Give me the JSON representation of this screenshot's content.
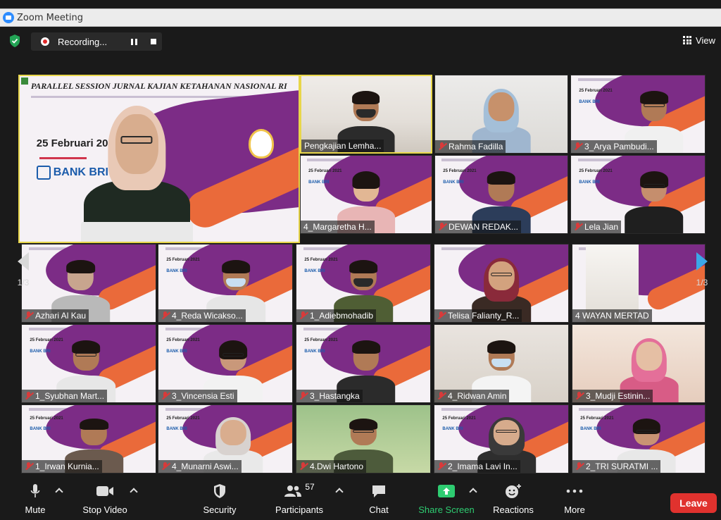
{
  "window": {
    "title": "Zoom Meeting"
  },
  "topbar": {
    "recording_label": "Recording...",
    "view_label": "View"
  },
  "speaker": {
    "slide_title": "PARALLEL SESSION JURNAL KAJIAN KETAHANAN NASIONAL RI",
    "slide_date": "25 Februari 2021",
    "slide_bank": "BANK BRI"
  },
  "participants": [
    {
      "name": "Pengkajian Lemha...",
      "muted": false
    },
    {
      "name": "Rahma Fadilla",
      "muted": true
    },
    {
      "name": "3_Arya Pambudi...",
      "muted": true
    },
    {
      "name": "4_Margaretha H...",
      "muted": false
    },
    {
      "name": "DEWAN REDAK...",
      "muted": true
    },
    {
      "name": "Lela Jian",
      "muted": true
    },
    {
      "name": "Azhari Al Kau",
      "muted": true
    },
    {
      "name": "4_Reda Wicakso...",
      "muted": true
    },
    {
      "name": "1_Adiebmohadib",
      "muted": true
    },
    {
      "name": "Telisa Falianty_R...",
      "muted": true
    },
    {
      "name": "4 WAYAN MERTAD",
      "muted": false
    },
    {
      "name": "1_Syubhan Mart...",
      "muted": true
    },
    {
      "name": "3_Vincensia Esti",
      "muted": true
    },
    {
      "name": "3_Hastangka",
      "muted": true
    },
    {
      "name": "4_Ridwan Amin",
      "muted": true
    },
    {
      "name": "3_Mudji Estinin...",
      "muted": true
    },
    {
      "name": "1_Irwan Kurnia...",
      "muted": true
    },
    {
      "name": "4_Munarni Aswi...",
      "muted": true
    },
    {
      "name": "4.Dwi Hartono",
      "muted": true
    },
    {
      "name": "2_Imama Lavi In...",
      "muted": true
    },
    {
      "name": "2_TRI SURATMI ...",
      "muted": true
    }
  ],
  "pagination": {
    "left": "1/3",
    "right": "1/3"
  },
  "toolbar": {
    "mute": "Mute",
    "stop_video": "Stop Video",
    "security": "Security",
    "participants": "Participants",
    "participants_count": "57",
    "chat": "Chat",
    "share_screen": "Share Screen",
    "reactions": "Reactions",
    "more": "More",
    "leave": "Leave"
  },
  "colors": {
    "share_green": "#2ecc71",
    "leave_red": "#e0322e",
    "speaker_border": "#e8d64a",
    "slide_purple": "#7c2c86",
    "slide_orange": "#ea6a3a"
  }
}
